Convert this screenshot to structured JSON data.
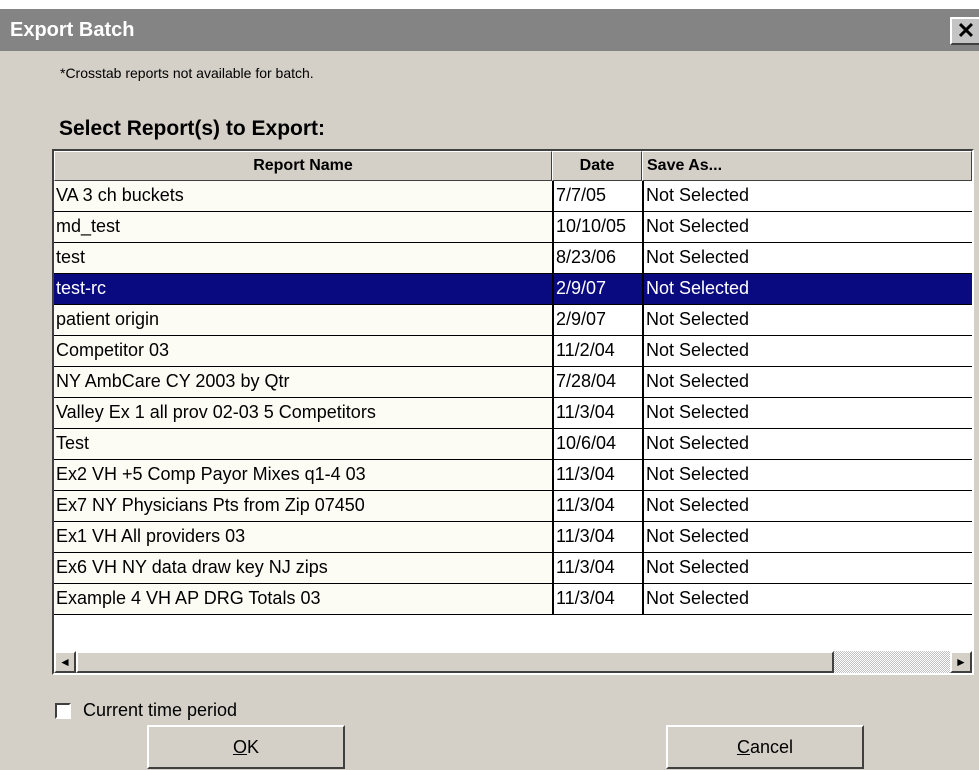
{
  "window": {
    "title": "Export Batch",
    "close_glyph": "✕"
  },
  "note": "*Crosstab reports not available for batch.",
  "heading": "Select Report(s) to Export:",
  "table": {
    "columns": [
      "Report Name",
      "Date",
      "Save As..."
    ],
    "selected_index": 3,
    "rows": [
      [
        "VA 3 ch buckets",
        "7/7/05",
        "Not Selected"
      ],
      [
        "md_test",
        "10/10/05",
        "Not Selected"
      ],
      [
        "test",
        "8/23/06",
        "Not Selected"
      ],
      [
        "test-rc",
        "2/9/07",
        "Not Selected"
      ],
      [
        "patient origin",
        "2/9/07",
        "Not Selected"
      ],
      [
        "Competitor 03",
        "11/2/04",
        "Not Selected"
      ],
      [
        "NY AmbCare CY 2003 by Qtr",
        "7/28/04",
        "Not Selected"
      ],
      [
        "Valley Ex 1 all prov 02-03   5 Competitors",
        "11/3/04",
        "Not Selected"
      ],
      [
        "Test",
        "10/6/04",
        "Not Selected"
      ],
      [
        "Ex2 VH +5 Comp Payor Mixes q1-4 03",
        "11/3/04",
        "Not Selected"
      ],
      [
        "Ex7 NY Physicians Pts from Zip 07450",
        "11/3/04",
        "Not Selected"
      ],
      [
        "Ex1 VH All providers 03",
        "11/3/04",
        "Not Selected"
      ],
      [
        "Ex6 VH NY data  draw key NJ zips",
        "11/3/04",
        "Not Selected"
      ],
      [
        "Example 4 VH  AP DRG Totals 03",
        "11/3/04",
        "Not Selected"
      ]
    ]
  },
  "scrollbar": {
    "left_glyph": "◄",
    "right_glyph": "►"
  },
  "checkbox": {
    "label": "Current time period",
    "checked": false
  },
  "buttons": {
    "ok": {
      "mnemonic": "O",
      "rest": "K"
    },
    "cancel": {
      "mnemonic": "C",
      "rest": "ancel"
    }
  },
  "colors": {
    "titlebar": "#848484",
    "dialog": "#d4d0c8",
    "selection": "#0a0a80"
  }
}
